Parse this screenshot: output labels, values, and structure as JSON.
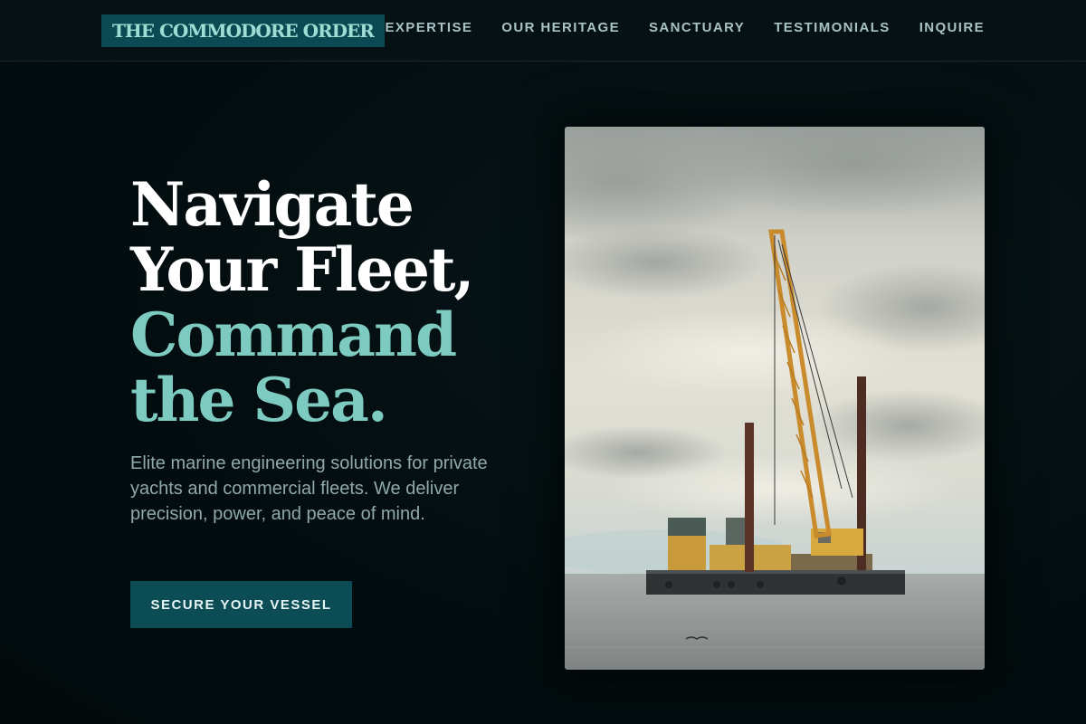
{
  "brand": {
    "name": "THE COMMODORE ORDER"
  },
  "nav": {
    "items": [
      {
        "label": "EXPERTISE"
      },
      {
        "label": "OUR HERITAGE"
      },
      {
        "label": "SANCTUARY"
      },
      {
        "label": "TESTIMONIALS"
      },
      {
        "label": "INQUIRE"
      }
    ]
  },
  "hero": {
    "title_line1": "Navigate",
    "title_line2": "Your Fleet,",
    "title_line3": "Command",
    "title_line4": "the Sea.",
    "description": "Elite marine engineering solutions for private yachts and commercial fleets. We deliver precision, power, and peace of mind.",
    "cta_label": "SECURE YOUR VESSEL",
    "image_alt": "Crane barge on open water under cloudy sky"
  },
  "colors": {
    "background": "#030f11",
    "accent_teal": "#7dcbc0",
    "button_bg": "#0b4c55",
    "brand_bg": "#0b4a52"
  },
  "icons": {
    "hero_image": "crane-barge-photo"
  }
}
